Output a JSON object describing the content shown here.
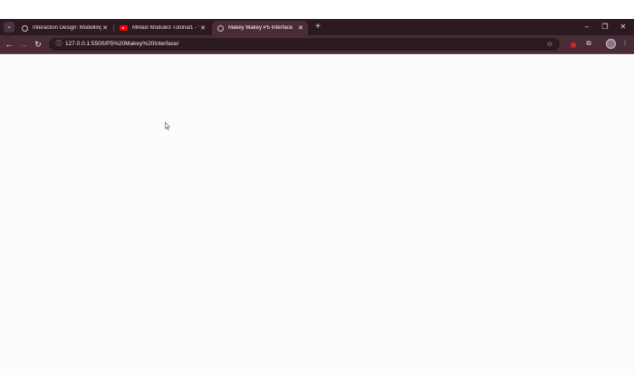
{
  "browser": {
    "tabs": [
      {
        "title": "Interaction Design: Modelling",
        "favicon": "globe-icon",
        "active": false
      },
      {
        "title": "MM&B Module3 Tutorial1 - Yo",
        "favicon": "youtube-icon",
        "active": false
      },
      {
        "title": "Makey Makey P5 Interface",
        "favicon": "globe-icon",
        "active": true
      }
    ],
    "tab_menu_icon": "chevron-down-icon",
    "new_tab_icon": "plus-icon",
    "close_tab_glyph": "✕",
    "address_bar": {
      "url": "127.0.0.1:5500/P5%20Makey%20Interface/"
    },
    "window_controls": {
      "minimize": "–",
      "restore": "❐",
      "close": "✕"
    }
  },
  "colors": {
    "tabstrip": "#2b1a22",
    "toolbar": "#4a2c38",
    "page_background": "#fcfcfc"
  }
}
